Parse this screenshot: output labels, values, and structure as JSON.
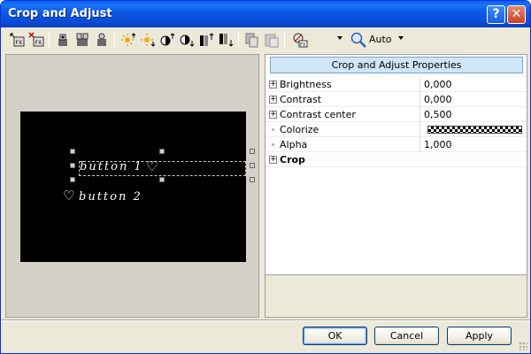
{
  "window": {
    "title": "Crop and Adjust"
  },
  "titlebar_buttons": {
    "help": "?",
    "close": "✕"
  },
  "toolbar": {
    "zoom_label": "Auto"
  },
  "preview": {
    "button1_text": "button 1",
    "button2_text": "button 2"
  },
  "properties": {
    "header": "Crop and Adjust Properties",
    "rows": [
      {
        "name": "Brightness",
        "value": "0,000",
        "expandable": true
      },
      {
        "name": "Contrast",
        "value": "0,000",
        "expandable": true
      },
      {
        "name": "Contrast center",
        "value": "0,500",
        "expandable": true
      },
      {
        "name": "Colorize",
        "value": "",
        "expandable": false
      },
      {
        "name": "Alpha",
        "value": "1,000",
        "expandable": false
      },
      {
        "name": "Crop",
        "value": "",
        "expandable": true
      }
    ]
  },
  "buttons": {
    "ok": "OK",
    "cancel": "Cancel",
    "apply": "Apply"
  },
  "colors": {
    "titlebar": "#0a5ef2",
    "props_header": "#cfe6f8",
    "window_bg": "#ece9d8"
  }
}
